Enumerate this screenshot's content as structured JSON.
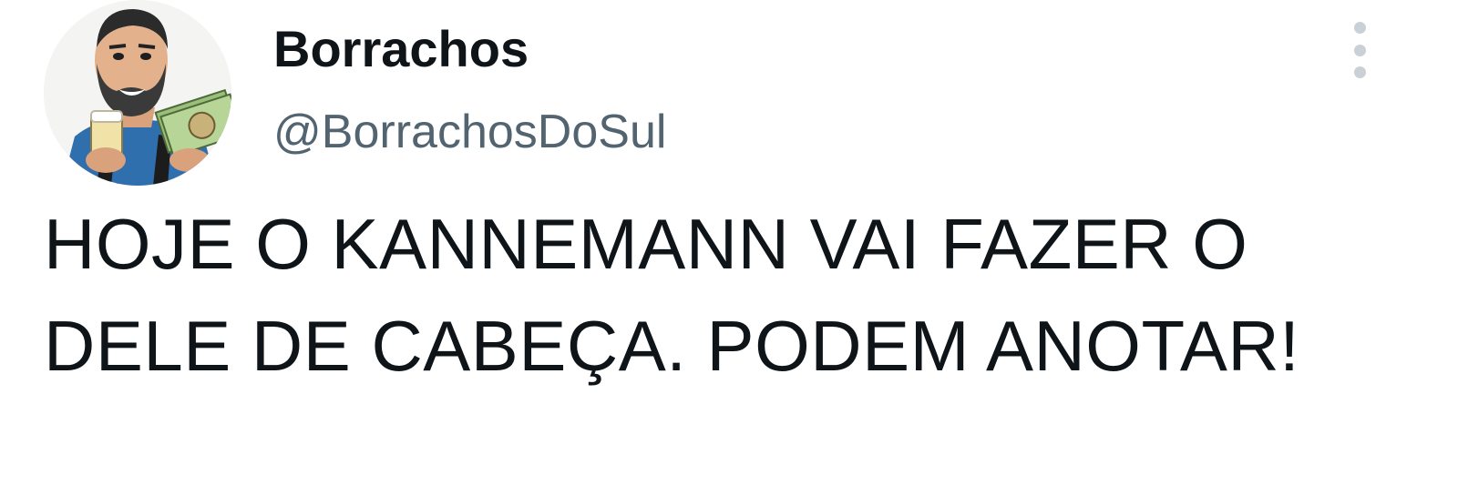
{
  "author": {
    "display_name": "Borrachos",
    "handle": "@BorrachosDoSul",
    "avatar_icon": "cartoon-man-with-beer-avatar"
  },
  "more_icon": "vertical-ellipsis-icon",
  "tweet": {
    "text": "HOJE O KANNEMANN VAI FAZER O\nDELE DE CABEÇA. PODEM ANOTAR!"
  },
  "colors": {
    "text_primary": "#0f1419",
    "text_secondary": "#536471",
    "more_icon": "#c9d0d6",
    "background": "#ffffff"
  }
}
